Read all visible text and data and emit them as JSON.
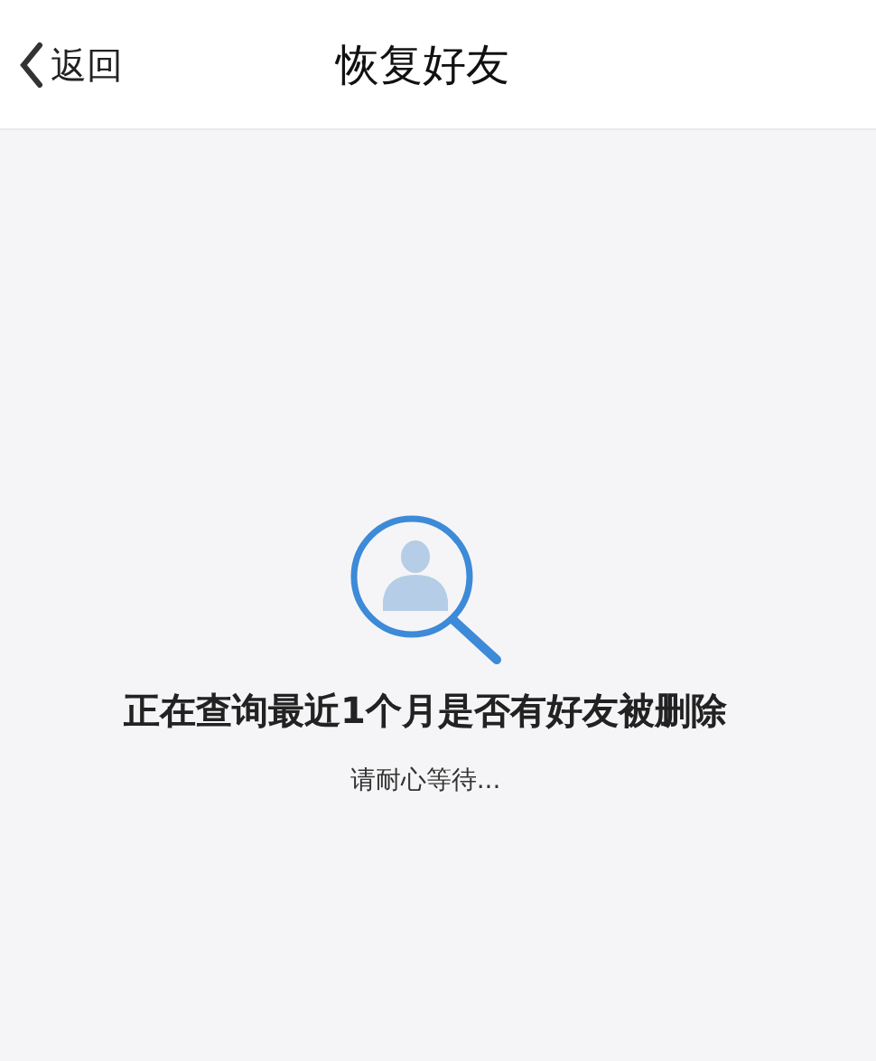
{
  "header": {
    "back_label": "返回",
    "title": "恢复好友"
  },
  "status": {
    "message": "正在查询最近1个月是否有好友被删除",
    "hint": "请耐心等待..."
  }
}
